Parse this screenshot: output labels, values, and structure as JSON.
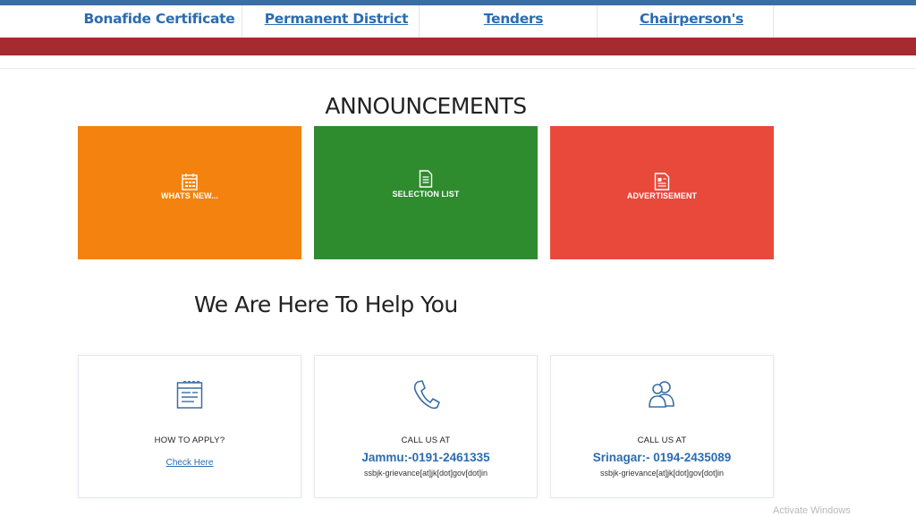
{
  "nav": {
    "items": [
      "Bonafide Certificate",
      "Permanent District Code",
      "Tenders",
      "Chairperson's Message"
    ]
  },
  "announcements": {
    "title": "ANNOUNCEMENTS",
    "tiles": [
      {
        "label": "WHATS NEW...",
        "color": "#f4820f",
        "icon": "calendar-icon"
      },
      {
        "label": "SELECTION LIST",
        "color": "#2e8b2e",
        "icon": "document-list-icon"
      },
      {
        "label": "ADVERTISEMENT",
        "color": "#e8493b",
        "icon": "newspaper-icon"
      }
    ]
  },
  "help": {
    "title": "We Are Here To Help You",
    "cards": [
      {
        "title": "HOW TO APPLY?",
        "link": "Check Here",
        "icon": "form-icon"
      },
      {
        "title": "CALL US AT",
        "phone": "Jammu:-0191-2461335",
        "email": "ssbjk-grievance[at]jk[dot]gov[dot]in",
        "icon": "phone-icon"
      },
      {
        "title": "CALL US AT",
        "phone": "Srinagar:- 0194-2435089",
        "email": "ssbjk-grievance[at]jk[dot]gov[dot]in",
        "icon": "users-icon"
      }
    ]
  },
  "watermark": "Activate Windows",
  "colors": {
    "nav_text": "#2b6cb0",
    "red_bar": "#a62a2e",
    "top_strip": "#3a6ea5"
  }
}
